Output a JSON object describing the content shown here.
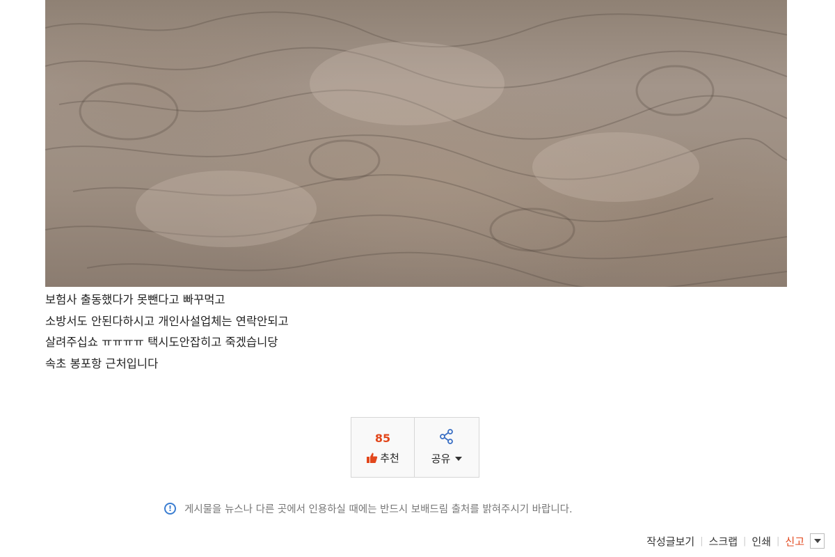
{
  "post": {
    "lines": [
      "보험사 출동했다가 못뺀다고 빠꾸먹고",
      "소방서도 안된다하시고 개인사설업체는 연락안되고",
      "살려주십쇼 ㅠㅠㅠㅠ 택시도안잡히고 죽겠습니당",
      "속초 봉포항 근처입니다"
    ]
  },
  "vote": {
    "count": "85",
    "recommend_label": "추천",
    "share_label": "공유"
  },
  "notice": {
    "icon": "!",
    "text": "게시물을 뉴스나 다른 곳에서 인용하실 때에는 반드시 보배드림 출처를 밝혀주시기 바랍니다."
  },
  "footer": {
    "view_author_posts": "작성글보기",
    "scrap": "스크랩",
    "print": "인쇄",
    "report": "신고"
  },
  "colors": {
    "accent": "#e2471c",
    "notice_icon": "#3a7dd1"
  }
}
